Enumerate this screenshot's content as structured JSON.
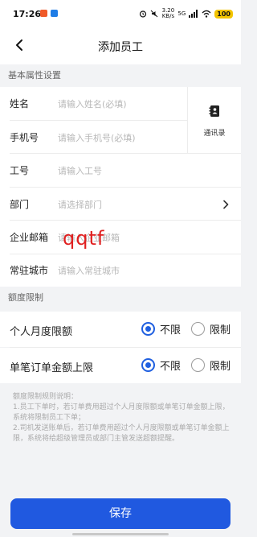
{
  "status_bar": {
    "time": "17:26",
    "network_speed": "3.20 KB/s",
    "signal": "5G",
    "battery": "100",
    "app_icon_colors": [
      "#f05a28",
      "#1f7de6",
      "#17b26a"
    ]
  },
  "header": {
    "title": "添加员工",
    "back_icon": "chevron-left-icon"
  },
  "basic_section": {
    "title": "基本属性设置",
    "fields": [
      {
        "label": "姓名",
        "placeholder": "请输入姓名(必填)"
      },
      {
        "label": "手机号",
        "placeholder": "请输入手机号(必填)"
      },
      {
        "label": "工号",
        "placeholder": "请输入工号"
      },
      {
        "label": "部门",
        "placeholder": "请选择部门"
      },
      {
        "label": "企业邮箱",
        "placeholder": "请输入企业邮箱"
      },
      {
        "label": "常驻城市",
        "placeholder": "请输入常驻城市"
      }
    ],
    "contacts_label": "通讯录",
    "contacts_icon": "address-book-icon"
  },
  "watermark": "qqtf",
  "limit_section": {
    "title": "额度限制",
    "rows": [
      {
        "label": "个人月度限额",
        "options": [
          "不限",
          "限制"
        ],
        "selected": "不限"
      },
      {
        "label": "单笔订单金额上限",
        "options": [
          "不限",
          "限制"
        ],
        "selected": "不限"
      }
    ]
  },
  "rules": {
    "title": "额度限制规则说明：",
    "items": [
      "1.员工下单时，若订单费用超过个人月度限额或单笔订单金额上限，系统将限制员工下单；",
      "2.司机发送账单后，若订单费用超过个人月度限额或单笔订单金额上限，系统将给超级管理员或部门主管发送超额提醒。"
    ]
  },
  "save_label": "保存",
  "colors": {
    "accent": "#2059e0",
    "background": "#f2f3f5",
    "placeholder": "#b7b7b7",
    "watermark": "#e02020"
  }
}
